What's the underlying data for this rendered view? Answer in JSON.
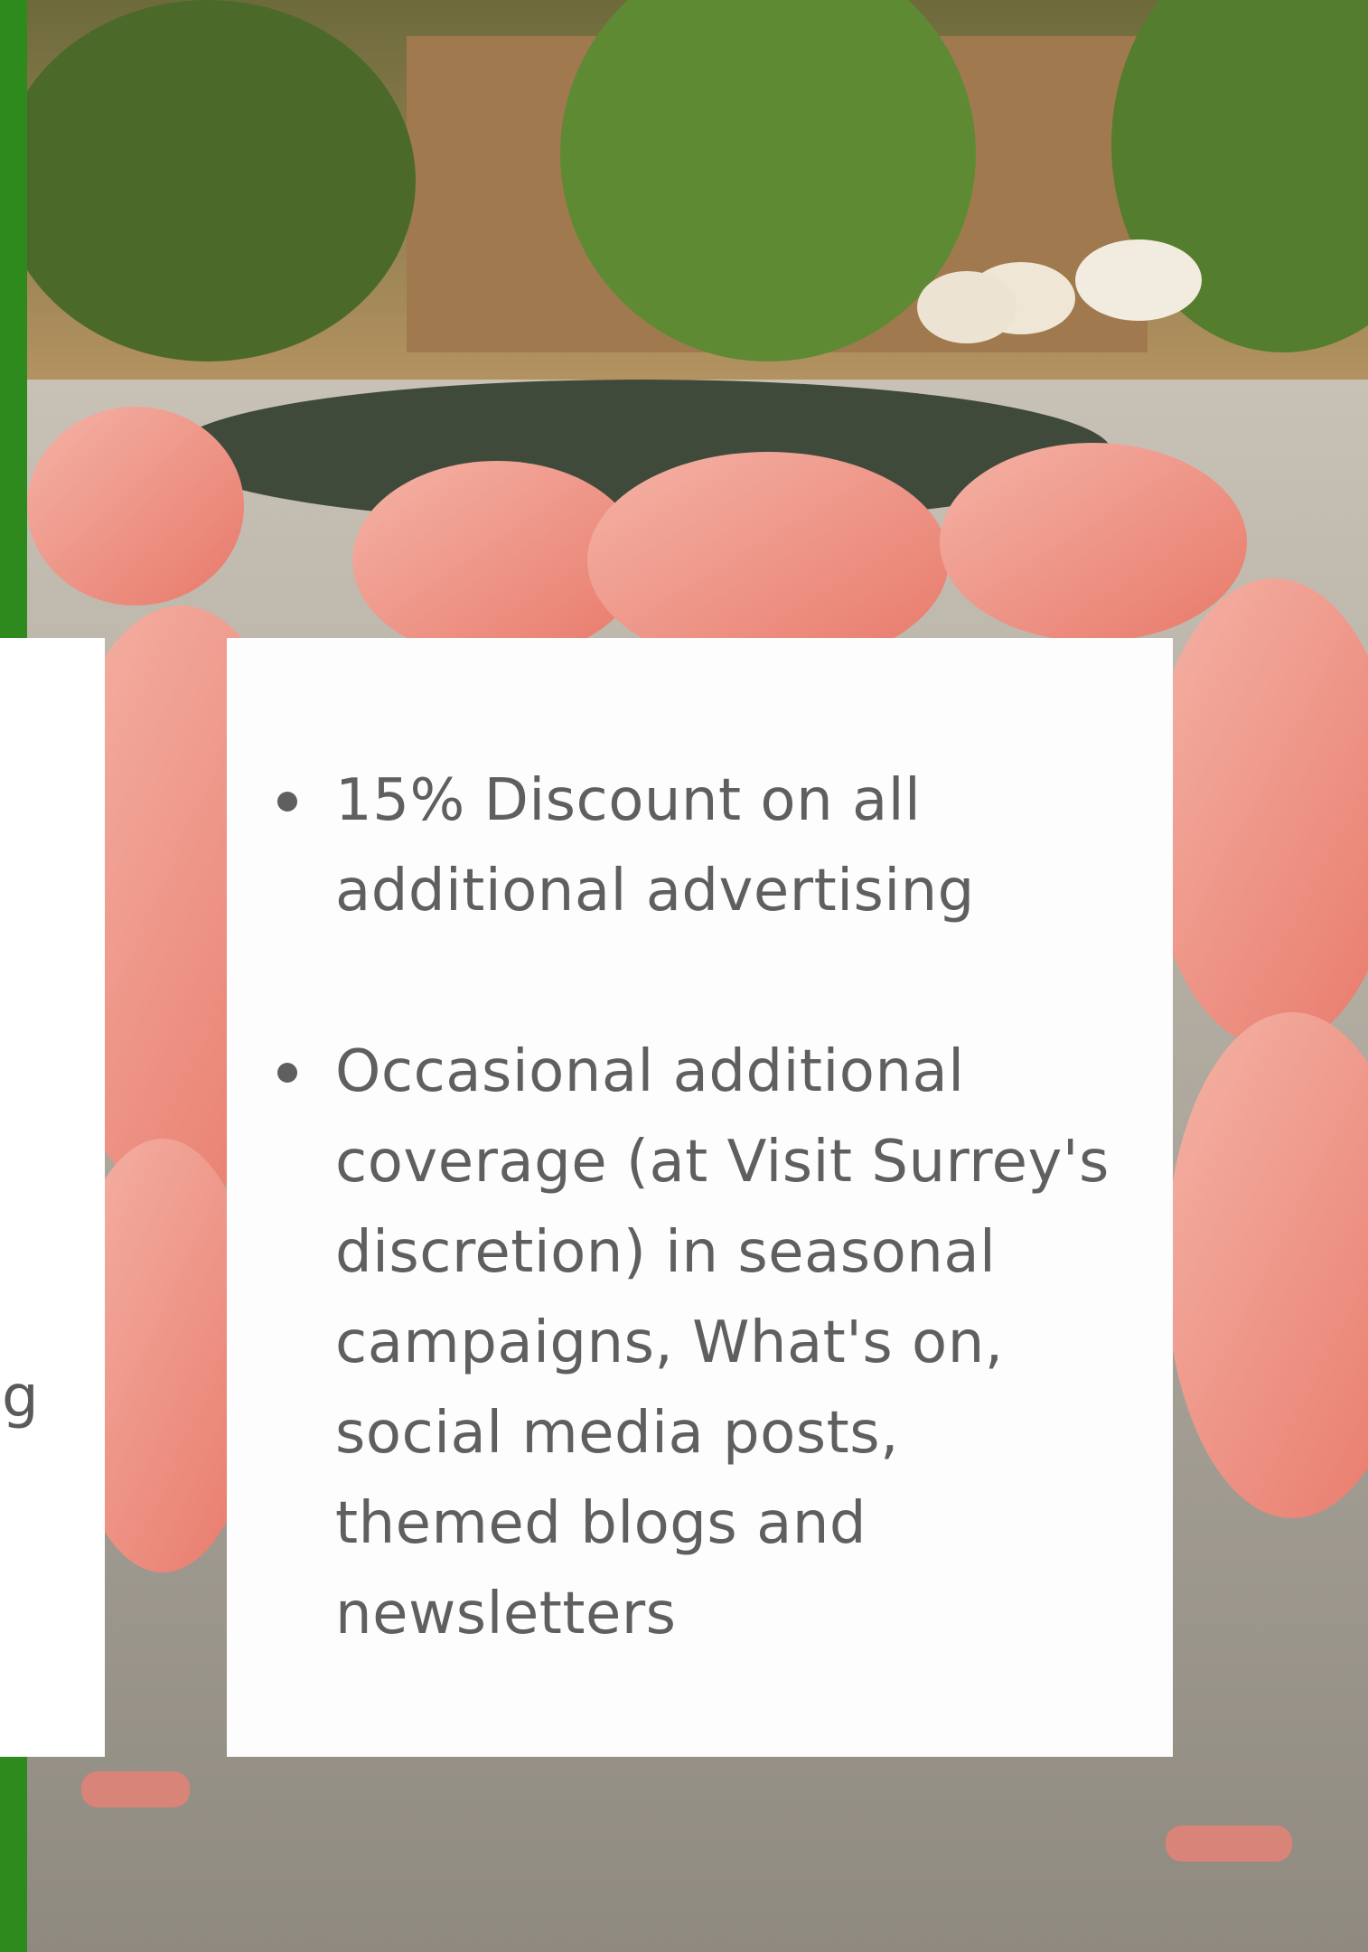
{
  "colors": {
    "accent_green": "#2f8a1e",
    "card_background": "#ffffff",
    "text_gray": "#5f5f5f"
  },
  "left_card": {
    "fragments": [
      "g"
    ]
  },
  "benefits": [
    {
      "text": "15% Discount on all additional advertising"
    },
    {
      "text": "Occasional additional coverage (at Visit Surrey's discretion) in seasonal campaigns, What's on, social media posts, themed blogs and newsletters"
    }
  ]
}
